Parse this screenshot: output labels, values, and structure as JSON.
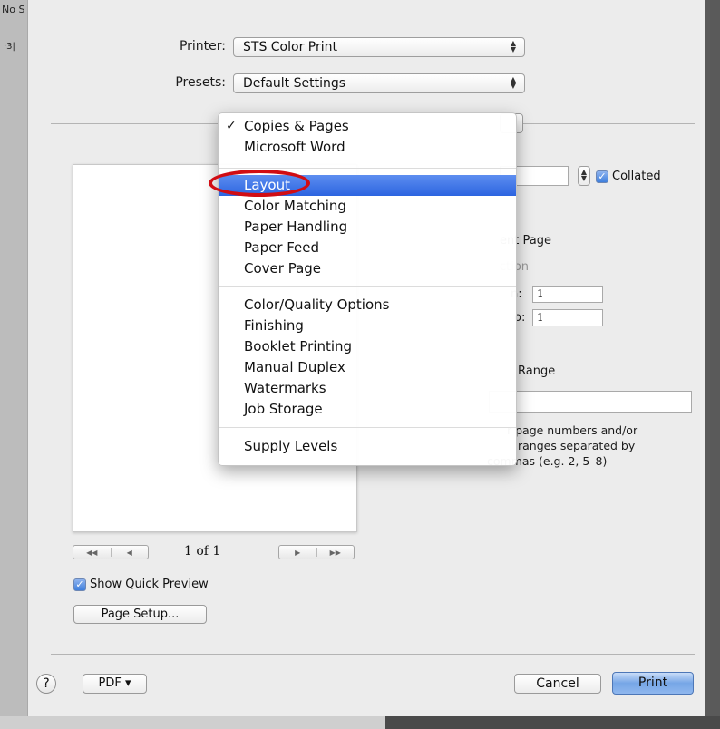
{
  "background": {
    "left_text_top": "No S",
    "left_text_ruler": "·3|"
  },
  "printer": {
    "label": "Printer:",
    "value": "STS Color Print"
  },
  "presets": {
    "label": "Presets:",
    "value": "Default Settings"
  },
  "section_popup": {
    "menu_items": [
      {
        "label": "Copies & Pages",
        "checked": true
      },
      {
        "label": "Microsoft Word"
      },
      {
        "label": "Layout",
        "highlighted": true
      },
      {
        "label": "Color Matching"
      },
      {
        "label": "Paper Handling"
      },
      {
        "label": "Paper Feed"
      },
      {
        "label": "Cover Page"
      },
      {
        "label": "Color/Quality Options"
      },
      {
        "label": "Finishing"
      },
      {
        "label": "Booklet Printing"
      },
      {
        "label": "Manual Duplex"
      },
      {
        "label": "Watermarks"
      },
      {
        "label": "Job Storage"
      },
      {
        "label": "Supply Levels"
      }
    ],
    "check_glyph": "✓"
  },
  "copies": {
    "collated_label": "Collated",
    "collated": true
  },
  "pages": {
    "current_page_label": "ent Page",
    "selection_label": "ction",
    "from_label": "n:",
    "from_value": "1",
    "to_label": "o:",
    "to_value": "1",
    "range_label": "Range",
    "hint_line1": "r page numbers and/or",
    "hint_line2": "ranges separated by",
    "hint_line3": "commas (e.g. 2, 5–8)"
  },
  "preview": {
    "page_info": "1 of 1"
  },
  "show_quick_preview": {
    "label": "Show Quick Preview",
    "checked": true
  },
  "buttons": {
    "page_setup": "Page Setup...",
    "help": "?",
    "pdf": "PDF ▾",
    "cancel": "Cancel",
    "print": "Print"
  },
  "colors": {
    "highlight": "#2c64e0",
    "annotation_ring": "#d10d14"
  }
}
